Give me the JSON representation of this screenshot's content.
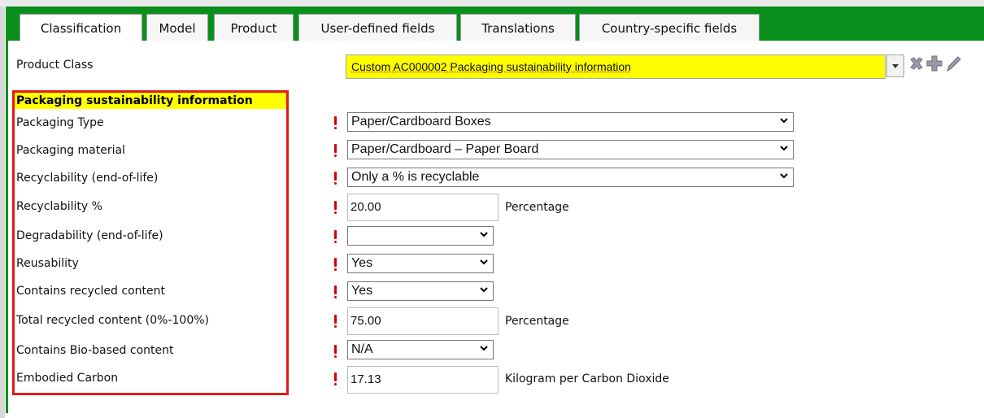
{
  "tabs": [
    {
      "label": "Classification",
      "active": true
    },
    {
      "label": "Model",
      "active": false
    },
    {
      "label": "Product",
      "active": false
    },
    {
      "label": "User-defined fields",
      "active": false
    },
    {
      "label": "Translations",
      "active": false
    },
    {
      "label": "Country-specific fields",
      "active": false
    }
  ],
  "product_class": {
    "label": "Product Class",
    "value": "Custom AC000002 Packaging sustainability information"
  },
  "section_title": "Packaging sustainability information",
  "fields": [
    {
      "label": "Packaging Type",
      "type": "select",
      "value": "Paper/Cardboard Boxes",
      "unit": ""
    },
    {
      "label": "Packaging material",
      "type": "select",
      "value": "Paper/Cardboard – Paper Board",
      "unit": ""
    },
    {
      "label": "Recyclability (end-of-life)",
      "type": "select",
      "value": "Only a % is recyclable",
      "unit": ""
    },
    {
      "label": "Recyclability %",
      "type": "input",
      "value": "20.00",
      "unit": "Percentage"
    },
    {
      "label": "Degradability (end-of-life)",
      "type": "select",
      "value": "",
      "unit": ""
    },
    {
      "label": "Reusability",
      "type": "select",
      "value": "Yes",
      "unit": ""
    },
    {
      "label": "Contains recycled content",
      "type": "select",
      "value": "Yes",
      "unit": ""
    },
    {
      "label": "Total recycled content (0%-100%)",
      "type": "input",
      "value": "75.00",
      "unit": "Percentage"
    },
    {
      "label": "Contains Bio-based content",
      "type": "select",
      "value": "N/A",
      "unit": ""
    },
    {
      "label": "Embodied Carbon",
      "type": "input",
      "value": "17.13",
      "unit": "Kilogram per Carbon Dioxide"
    }
  ],
  "icons": {
    "clear": "clear-icon",
    "add": "add-icon",
    "edit": "edit-icon"
  },
  "colors": {
    "tab_bar": "#0a8f1d",
    "highlight": "#ffff00",
    "required": "#d40000",
    "outline": "#e01b1b"
  }
}
